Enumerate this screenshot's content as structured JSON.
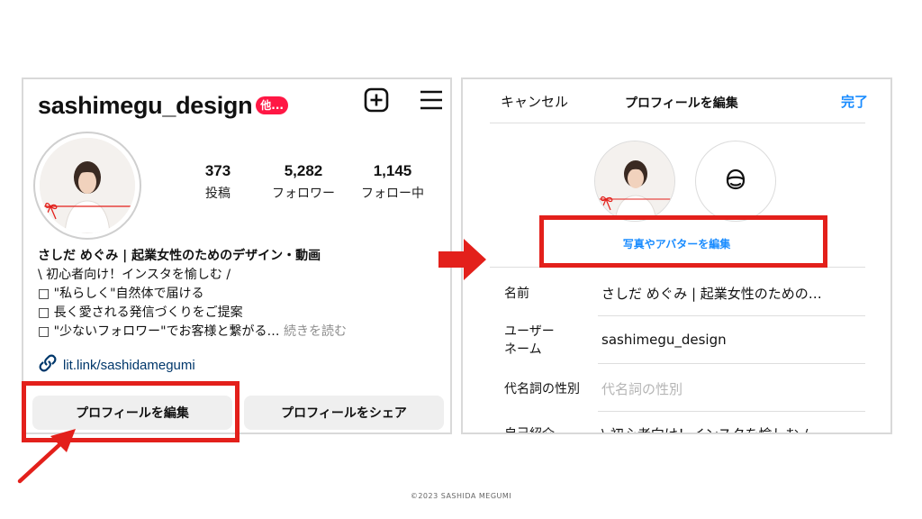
{
  "left": {
    "username": "sashimegu_design",
    "notif_badge": "他...",
    "stats": [
      {
        "value": "373",
        "label": "投稿"
      },
      {
        "value": "5,282",
        "label": "フォロワー"
      },
      {
        "value": "1,145",
        "label": "フォロー中"
      }
    ],
    "bio": {
      "name": "さしだ めぐみ | 起業女性のためのデザイン・動画",
      "line1": "\\ 初心者向け！インスタを愉しむ /",
      "line2": "□ \"私らしく\"自然体で届ける",
      "line3": "□ 長く愛される発信づくりをご提案",
      "line4": "□ \"少ないフォロワー\"でお客様と繋がる…",
      "more": "続きを読む"
    },
    "link": "lit.link/sashidamegumi",
    "buttons": {
      "edit": "プロフィールを編集",
      "share": "プロフィールをシェア"
    }
  },
  "right": {
    "cancel": "キャンセル",
    "title": "プロフィールを編集",
    "done": "完了",
    "edit_photo": "写真やアバターを編集",
    "fields": [
      {
        "label": "名前",
        "value": "さしだ めぐみ | 起業女性のための…"
      },
      {
        "label": "ユーザー\nネーム",
        "value": "sashimegu_design"
      },
      {
        "label": "代名詞の性別",
        "placeholder": "代名詞の性別"
      },
      {
        "label": "自己紹介",
        "value": "\\ 初心者向け！インスタを愉しむ /"
      }
    ]
  },
  "footer": "©2023  SASHIDA  MEGUMI",
  "colors": {
    "accent_blue": "#1a8cff",
    "callout_red": "#e3201b",
    "badge_red": "#ff1744",
    "link_blue": "#00376b"
  },
  "icons": [
    "plus-square-icon",
    "hamburger-menu-icon",
    "link-icon",
    "avatar-face-icon",
    "right-arrow-icon",
    "pointer-arrow-icon"
  ]
}
